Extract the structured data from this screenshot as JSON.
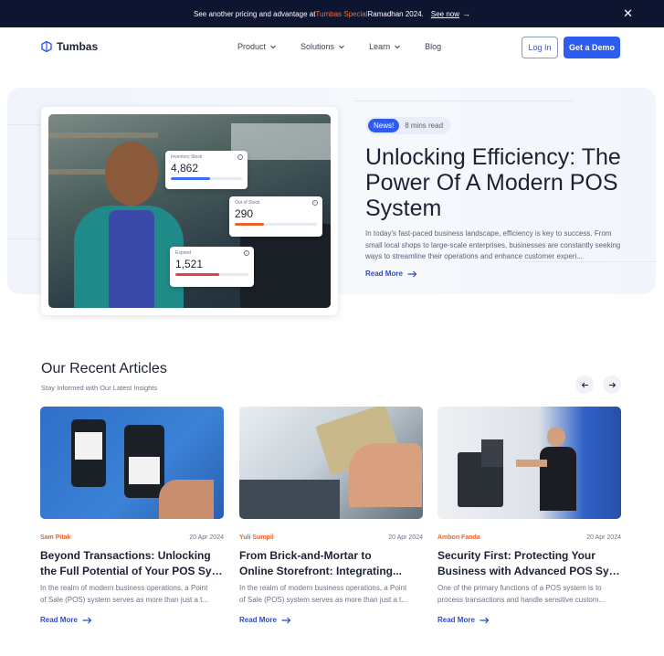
{
  "announcement": {
    "text_before": "See another pricing and advantage at ",
    "highlight": "Tumbas Special",
    "text_after": " Ramadhan 2024.",
    "link": "See now",
    "arrow_icon": "arrow-right-icon",
    "close_icon": "close-icon",
    "close_glyph": "✕"
  },
  "nav": {
    "logo": "Tumbas",
    "items": [
      {
        "label": "Product",
        "dropdown": true
      },
      {
        "label": "Solutions",
        "dropdown": true
      },
      {
        "label": "Learn",
        "dropdown": true
      },
      {
        "label": "Blog",
        "dropdown": false
      }
    ],
    "login": "Log In",
    "demo": "Get a Demo"
  },
  "hero": {
    "badge": "News!",
    "read_time": "8 mins read",
    "title": "Unlocking Efficiency: The Power Of A Modern POS System",
    "description": "In today's fast-paced business landscape, efficiency is key to success. From small local shops to large-scale enterprises, businesses are constantly seeking ways to streamline their operations and enhance customer experi...",
    "read_more": "Read More",
    "stats": [
      {
        "label": "Inventory Stock",
        "value": "4,862",
        "bar_color": "#3a6df0",
        "bar_fill": 0.55
      },
      {
        "label": "Out of Stock",
        "value": "290",
        "bar_color": "#e8642c",
        "bar_fill": 0.35
      },
      {
        "label": "Expired",
        "value": "1,521",
        "bar_color": "#e0404a",
        "bar_fill": 0.6
      }
    ]
  },
  "articles": {
    "title": "Our Recent Articles",
    "subtitle": "Stay Informed with Our Latest Insights",
    "prev_icon": "arrow-left-icon",
    "next_icon": "arrow-right-icon",
    "items": [
      {
        "author": "Sam Pitak",
        "date": "20 Apr 2024",
        "title_line1": "Beyond Transactions: Unlocking",
        "title_line2": "the Full Potential of Your POS Sys...",
        "excerpt_line1": "In the realm of modern business operations, a Point",
        "excerpt_line2": "of Sale (POS) system serves as more than just a t...",
        "read_more": "Read More"
      },
      {
        "author": "Yuli Sumpil",
        "date": "20 Apr 2024",
        "title_line1": "From Brick-and-Mortar to",
        "title_line2": "Online Storefront: Integrating...",
        "excerpt_line1": "In the realm of modern business operations, a Point",
        "excerpt_line2": "of Sale (POS) system serves as more than just a t...",
        "read_more": "Read More"
      },
      {
        "author": "Ambon Fanda",
        "date": "20 Apr 2024",
        "title_line1": "Security First: Protecting Your",
        "title_line2": "Business with Advanced POS Sys...",
        "excerpt_line1": "One of the primary functions of a POS system is to",
        "excerpt_line2": "process transactions and handle sensitive custom...",
        "read_more": "Read More"
      }
    ]
  }
}
